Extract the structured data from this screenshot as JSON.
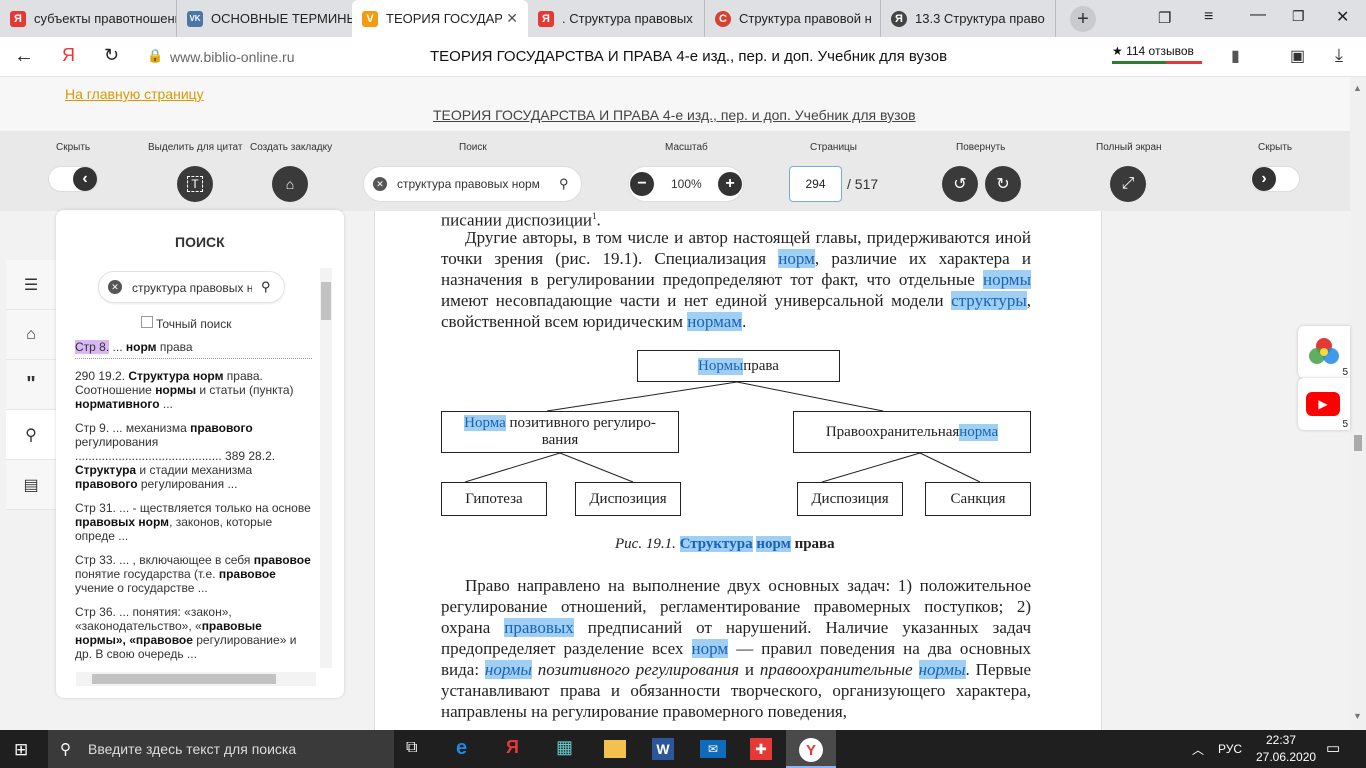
{
  "tabs": [
    {
      "title": "субъекты правотношения",
      "favicon_color": "#e53935",
      "favicon": "Я"
    },
    {
      "title": "ОСНОВНЫЕ ТЕРМИНЫ",
      "favicon_color": "#4a76a8",
      "favicon": "VK"
    },
    {
      "title": "ТЕОРИЯ ГОСУДАРСТВА",
      "favicon_color": "#f39c12",
      "favicon": "V"
    },
    {
      "title": ". Структура правовых",
      "favicon_color": "#e53935",
      "favicon": "Я"
    },
    {
      "title": "Структура правовой н",
      "favicon_color": "#d8412f",
      "favicon": "С"
    },
    {
      "title": "13.3 Структура право",
      "favicon_color": "#444",
      "favicon": "Я"
    }
  ],
  "address": {
    "url": "www.biblio-online.ru",
    "page_title": "ТЕОРИЯ ГОСУДАРСТВА И ПРАВА 4-е изд., пер. и доп. Учебник для вузов",
    "reviews": "★ 114 отзывов"
  },
  "banner": {
    "home_link": "На главную страницу",
    "book_title": "ТЕОРИЯ ГОСУДАРСТВА И ПРАВА 4-е изд., пер. и доп. Учебник для вузов"
  },
  "toolbar": {
    "hide_left": "Скрыть",
    "highlight": "Выделить для цитат",
    "bookmark": "Создать закладку",
    "search": "Поиск",
    "scale": "Масштаб",
    "pages": "Страницы",
    "rotate": "Повернуть",
    "fullscreen": "Полный экран",
    "hide_right": "Скрыть",
    "search_value": "структура правовых норм",
    "zoom": "100%",
    "page_current": "294",
    "page_total": "/ 517"
  },
  "sidebar": {
    "title": "ПОИСК",
    "search_value": "структура правовых н",
    "exact_label": "Точный поиск"
  },
  "document": {
    "line0": "писании диспозиции",
    "figure_caption_italic": "Рис. 19.1.",
    "figure_caption_bold_end": "права",
    "boxes": {
      "root_a": "Нормы",
      "root_b": " права",
      "left_a": "Норма",
      "left_b": " позитивного регулиро-вания",
      "right_a": "Правоохранительная ",
      "right_b": "норма",
      "l1": "Гипотеза",
      "l2": "Диспозиция",
      "r1": "Диспозиция",
      "r2": "Санкция"
    }
  },
  "taskbar": {
    "search_placeholder": "Введите здесь текст для поиска",
    "lang": "РУС",
    "time": "22:37",
    "date": "27.06.2020"
  },
  "rightbar": {
    "count1": "5",
    "count2": "5"
  }
}
